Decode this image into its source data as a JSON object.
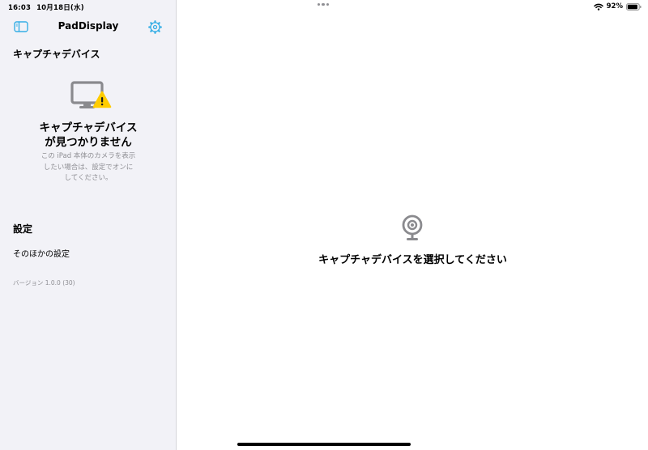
{
  "status_bar": {
    "time": "16:03",
    "date": "10月18日(水)",
    "battery_percent": "92%",
    "battery_level": 0.92
  },
  "sidebar": {
    "title": "PadDisplay",
    "toggle_icon": "sidebar-icon",
    "settings_icon": "gear-icon",
    "capture_section": {
      "header": "キャプチャデバイス",
      "icon": "display-warning-icon",
      "empty_title_line1": "キャプチャデバイス",
      "empty_title_line2": "が見つかりません",
      "empty_desc_line1": "この iPad 本体のカメラを表示",
      "empty_desc_line2": "したい場合は、設定でオンに",
      "empty_desc_line3": "してください。"
    },
    "settings_section": {
      "header": "設定",
      "other_settings": "そのほかの設定"
    },
    "version": "バージョン 1.0.0 (30)"
  },
  "detail": {
    "icon": "webcam-icon",
    "placeholder": "キャプチャデバイスを選択してください"
  },
  "colors": {
    "accent": "#35aee5",
    "sidebar_bg": "#f2f2f7",
    "warning": "#ffcc00",
    "secondary_text": "#8e8e93",
    "icon_gray": "#8a8a8e"
  }
}
